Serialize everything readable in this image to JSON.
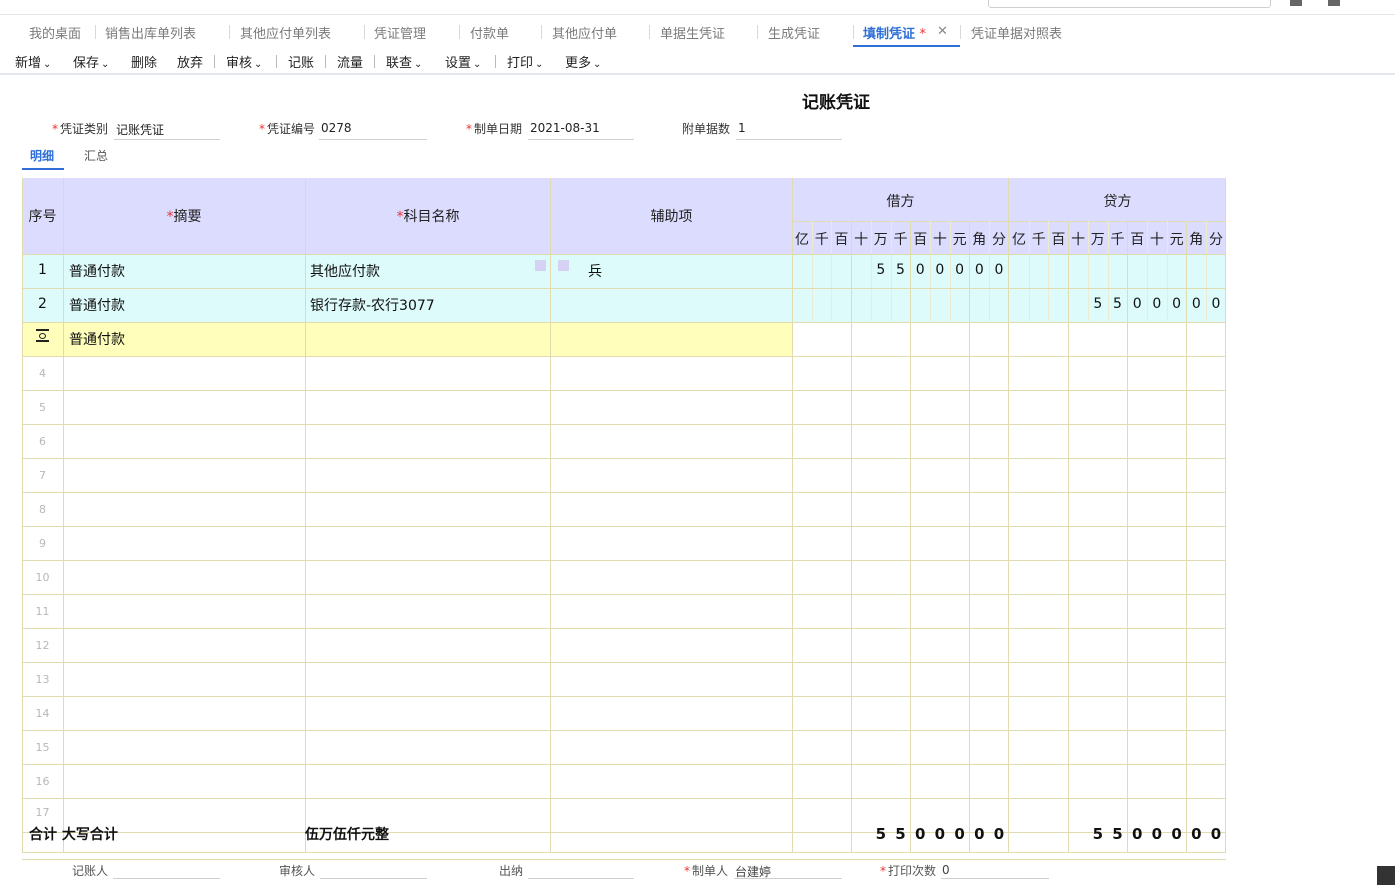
{
  "tabs": [
    {
      "label": "我的桌面"
    },
    {
      "label": "销售出库单列表"
    },
    {
      "label": "其他应付单列表"
    },
    {
      "label": "凭证管理"
    },
    {
      "label": "付款单"
    },
    {
      "label": "其他应付单"
    },
    {
      "label": "单据生凭证"
    },
    {
      "label": "生成凭证"
    },
    {
      "label": "填制凭证",
      "active": true,
      "modified_mark": "*"
    },
    {
      "label": "凭证单据对照表"
    }
  ],
  "toolbar": {
    "add": "新增",
    "save": "保存",
    "delete": "删除",
    "discard": "放弃",
    "audit": "审核",
    "post": "记账",
    "flow": "流量",
    "query": "联查",
    "settings": "设置",
    "print": "打印",
    "more": "更多",
    "caret": "⌄"
  },
  "voucher": {
    "title": "记账凭证",
    "type_label": "凭证类别",
    "type_value": "记账凭证",
    "number_label": "凭证编号",
    "number_value": "0278",
    "date_label": "制单日期",
    "date_value": "2021-08-31",
    "attach_label": "附单据数",
    "attach_value": "1",
    "required_mark": "*"
  },
  "subtabs": {
    "detail": "明细",
    "summary": "汇总"
  },
  "grid": {
    "headers": {
      "seq": "序号",
      "summary": "摘要",
      "account": "科目名称",
      "aux": "辅助项",
      "debit": "借方",
      "credit": "贷方"
    },
    "units": [
      "亿",
      "千",
      "百",
      "十",
      "万",
      "千",
      "百",
      "十",
      "元",
      "角",
      "分"
    ],
    "rows": [
      {
        "seq": "1",
        "summary": "普通付款",
        "account": "其他应付款",
        "aux": "兵",
        "debit_digits": [
          "",
          "",
          "",
          "",
          "5",
          "5",
          "0",
          "0",
          "0",
          "0",
          "0"
        ],
        "credit_digits": [
          "",
          "",
          "",
          "",
          "",
          "",
          "",
          "",
          "",
          "",
          ""
        ]
      },
      {
        "seq": "2",
        "summary": "普通付款",
        "account": "银行存款-农行3077",
        "aux": "",
        "debit_digits": [
          "",
          "",
          "",
          "",
          "",
          "",
          "",
          "",
          "",
          "",
          ""
        ],
        "credit_digits": [
          "",
          "",
          "",
          "",
          "5",
          "5",
          "0",
          "0",
          "0",
          "0",
          "0"
        ]
      },
      {
        "seq": "",
        "summary": "普通付款",
        "account": "",
        "aux": "",
        "debit_digits": [
          "",
          "",
          "",
          "",
          "",
          "",
          "",
          "",
          "",
          "",
          ""
        ],
        "credit_digits": [
          "",
          "",
          "",
          "",
          "",
          "",
          "",
          "",
          "",
          "",
          ""
        ]
      }
    ],
    "empty_rows": [
      "4",
      "5",
      "6",
      "7",
      "8",
      "9",
      "10",
      "11",
      "12",
      "13",
      "14",
      "15",
      "16",
      "17"
    ],
    "total": {
      "label": "合计 大写合计",
      "amount_words": "伍万伍仟元整",
      "debit_digits": [
        "5",
        "5",
        "0",
        "0",
        "0",
        "0",
        "0"
      ],
      "credit_digits": [
        "5",
        "5",
        "0",
        "0",
        "0",
        "0",
        "0"
      ]
    }
  },
  "footer": {
    "bookkeeper_label": "记账人",
    "auditor_label": "审核人",
    "cashier_label": "出纳",
    "maker_label": "制单人",
    "maker_value": "台建婷",
    "print_label": "打印次数",
    "print_value": "0"
  },
  "colors": {
    "header_bg": "#dcdcff",
    "posted_row_bg": "#ddfbfb",
    "editing_row_bg": "#ffffbb",
    "accent": "#2f6fd6",
    "required": "#ee3333"
  }
}
